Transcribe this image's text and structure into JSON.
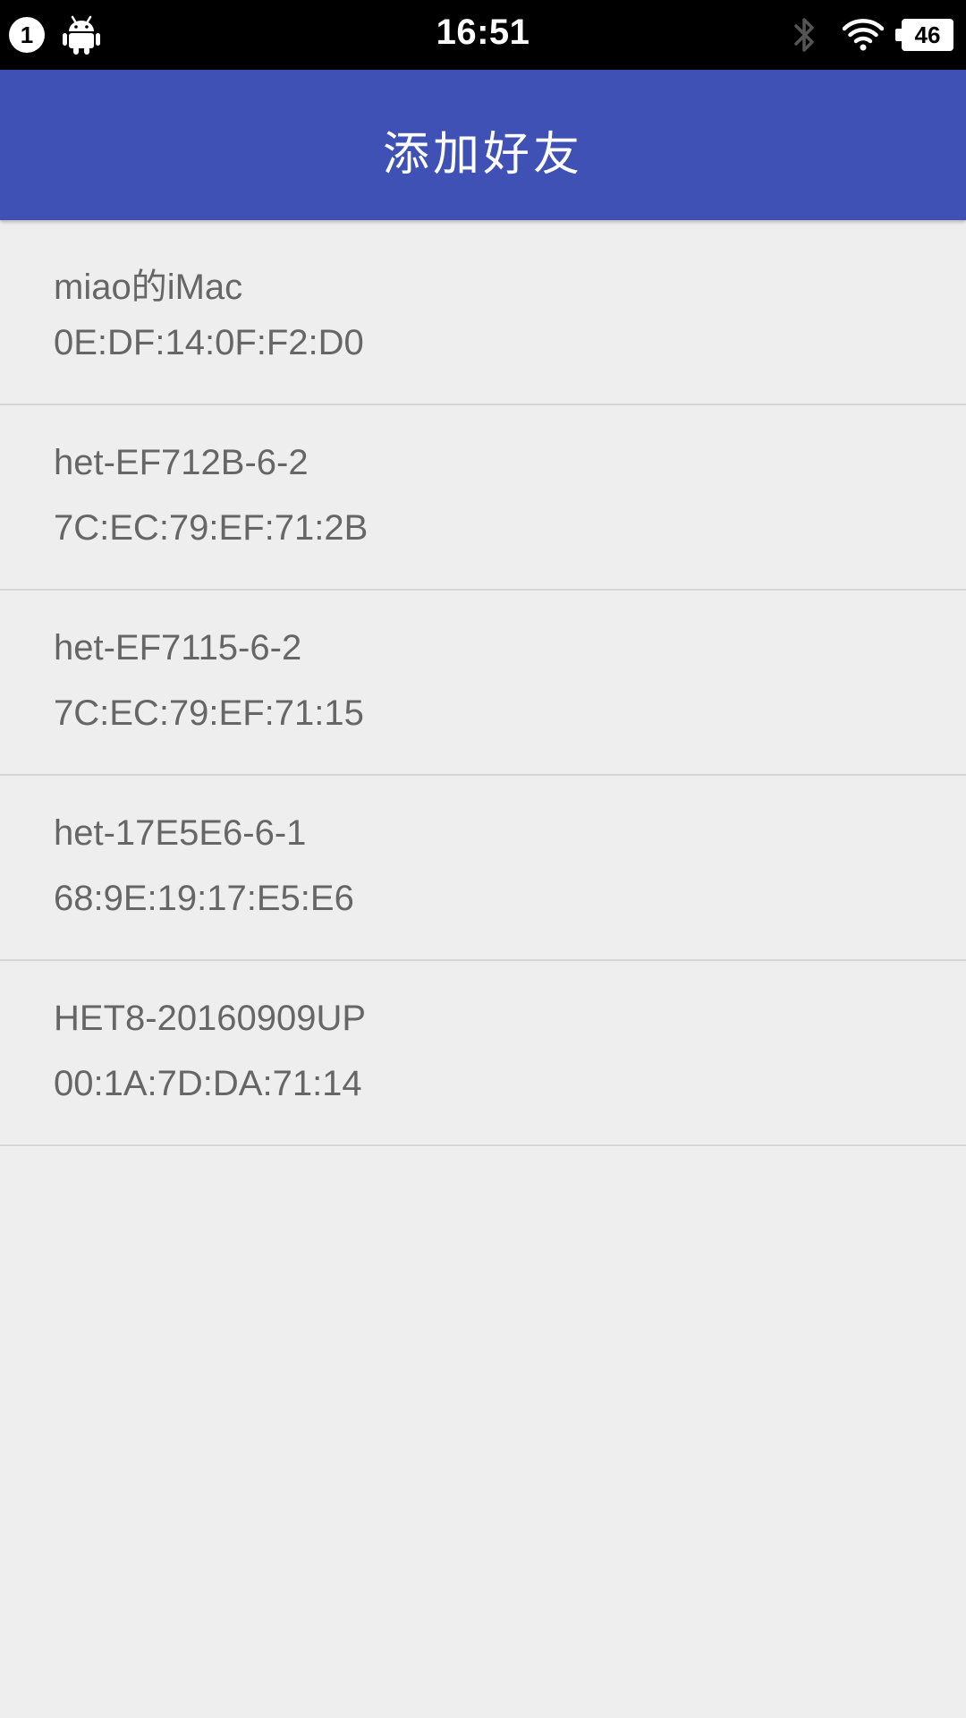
{
  "status_bar": {
    "notification_count": "1",
    "time": "16:51",
    "battery_level": "46",
    "icons": [
      "notification-badge-icon",
      "android-icon",
      "bluetooth-icon",
      "wifi-icon",
      "battery-icon"
    ]
  },
  "app_bar": {
    "title": "添加好友",
    "color": "#3f51b5"
  },
  "devices": [
    {
      "name": "miao的iMac",
      "mac": "0E:DF:14:0F:F2:D0"
    },
    {
      "name": "het-EF712B-6-2",
      "mac": "7C:EC:79:EF:71:2B"
    },
    {
      "name": "het-EF7115-6-2",
      "mac": "7C:EC:79:EF:71:15"
    },
    {
      "name": "het-17E5E6-6-1",
      "mac": "68:9E:19:17:E5:E6"
    },
    {
      "name": "HET8-20160909UP",
      "mac": "00:1A:7D:DA:71:14"
    }
  ]
}
